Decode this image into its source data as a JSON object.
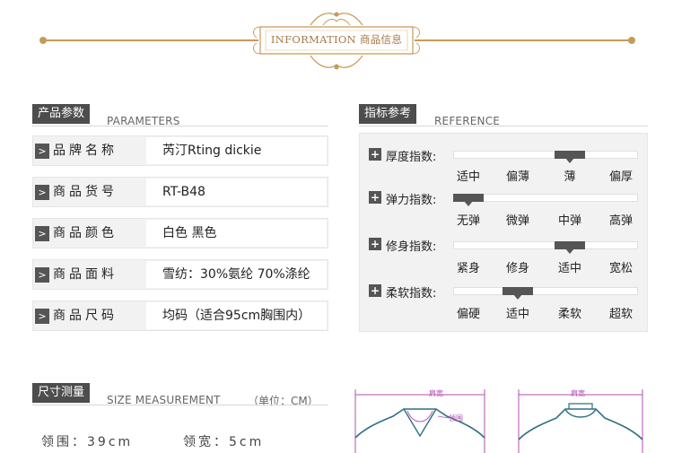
{
  "header": {
    "title": "INFORMATION 商品信息"
  },
  "parameters": {
    "tag": "产品参数",
    "tag_en": "PARAMETERS",
    "rows": [
      {
        "label": "品牌名称",
        "value": "芮汀Rting dickie"
      },
      {
        "label": "商品货号",
        "value": "RT-B48"
      },
      {
        "label": "商品颜色",
        "value": "白色  黑色"
      },
      {
        "label": "商品面料",
        "value": "雪纺：30%氨纶  70%涤纶"
      },
      {
        "label": "商品尺码",
        "value": "均码（适合95cm胸围内）"
      }
    ]
  },
  "reference": {
    "tag": "指标参考",
    "tag_en": "REFERENCE",
    "indicators": [
      {
        "label": "厚度指数:",
        "levels": [
          "适中",
          "偏薄",
          "薄",
          "偏厚"
        ],
        "selected_index": 2
      },
      {
        "label": "弹力指数:",
        "levels": [
          "无弹",
          "微弹",
          "中弹",
          "高弹"
        ],
        "selected_index": 0
      },
      {
        "label": "修身指数:",
        "levels": [
          "紧身",
          "修身",
          "适中",
          "宽松"
        ],
        "selected_index": 2
      },
      {
        "label": "柔软指数:",
        "levels": [
          "偏硬",
          "适中",
          "柔软",
          "超软"
        ],
        "selected_index": 1
      }
    ]
  },
  "size": {
    "tag": "尺寸测量",
    "tag_en": "SIZE MEASUREMENT",
    "unit": "（单位：CM）",
    "collar_circ": "领围：39cm",
    "collar_width": "领宽：5cm",
    "diagram_labels": {
      "shoulder": "肩宽",
      "collar": "领围",
      "shoulder2": "肩宽"
    }
  },
  "colors": {
    "accent_gold": "#c79a5a",
    "dark_tag": "#4d4d4d",
    "diagram_purple": "#b04fb0",
    "diagram_teal": "#2f6f86"
  }
}
